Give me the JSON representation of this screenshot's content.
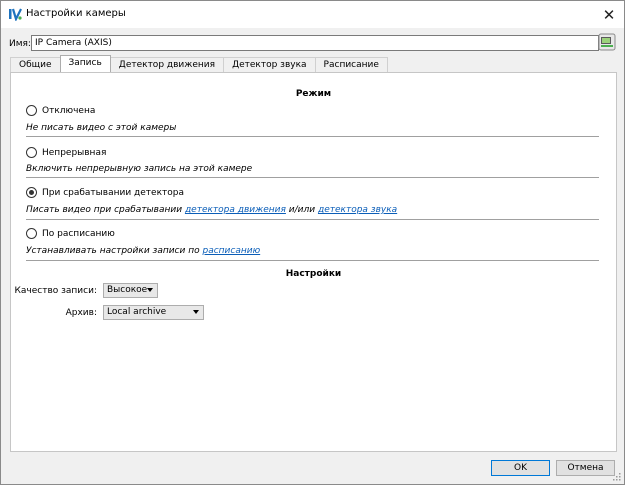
{
  "window": {
    "title": "Настройки камеры"
  },
  "name": {
    "label": "Имя:",
    "value": "IP Camera (AXIS)"
  },
  "tabs": [
    {
      "label": "Общие",
      "active": false
    },
    {
      "label": "Запись",
      "active": true
    },
    {
      "label": "Детектор движения",
      "active": false
    },
    {
      "label": "Детектор звука",
      "active": false
    },
    {
      "label": "Расписание",
      "active": false
    }
  ],
  "mode": {
    "title": "Режим",
    "options": [
      {
        "label": "Отключена",
        "checked": false,
        "description": "Не писать видео с этой камеры"
      },
      {
        "label": "Непрерывная",
        "checked": false,
        "description": "Включить непрерывную запись на этой камере"
      },
      {
        "label": "При срабатывании детектора",
        "checked": true,
        "description_prefix": "Писать видео при срабатывании ",
        "link_motion": "детектора движения",
        "description_middle": " и/или ",
        "link_sound": "детектора звука"
      },
      {
        "label": "По расписанию",
        "checked": false,
        "description_prefix": "Устанавливать настройки записи по ",
        "link_schedule": "расписанию"
      }
    ]
  },
  "settings": {
    "title": "Настройки",
    "quality": {
      "label": "Качество записи:",
      "value": "Высокое"
    },
    "archive": {
      "label": "Архив:",
      "value": "Local archive"
    }
  },
  "buttons": {
    "ok": "OK",
    "cancel": "Отмена"
  },
  "colors": {
    "link": "#0b5eb8",
    "primary_border": "#0078d7",
    "icon_blue": "#1e73be",
    "icon_green": "#4caf50"
  },
  "icons": {
    "app": "iv-logo-icon",
    "close": "close-icon",
    "name_action": "camera-settings-icon"
  }
}
